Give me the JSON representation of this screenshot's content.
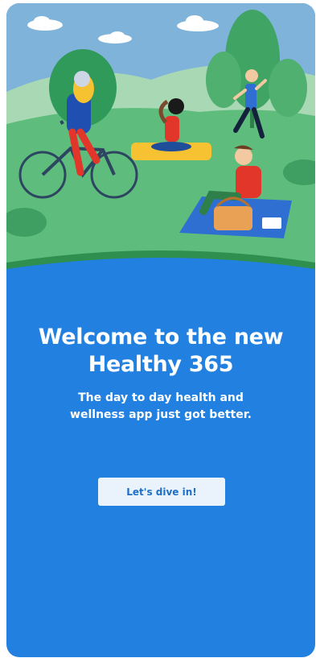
{
  "onboarding": {
    "title_line1": "Welcome to the new",
    "title_line2": "Healthy 365",
    "subtitle_line1": "The day to day health and",
    "subtitle_line2": "wellness app just got better.",
    "cta_label": "Let's dive in!"
  },
  "colors": {
    "background_blue": "#2180e0",
    "sky": "#7fb3da",
    "grass": "#5ebd7c",
    "cta_bg": "#eaf3fc",
    "cta_text": "#1d6fc7"
  }
}
